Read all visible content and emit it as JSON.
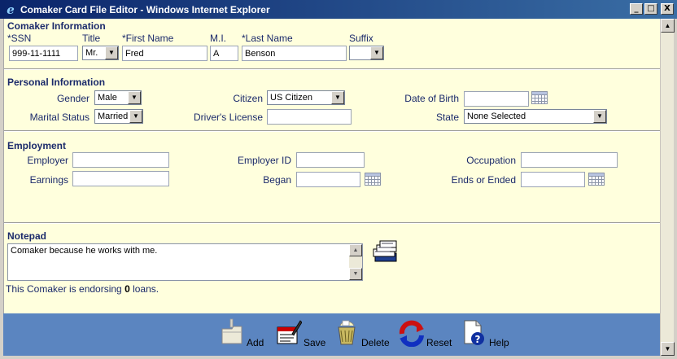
{
  "window": {
    "title": "Comaker Card File Editor - Windows Internet Explorer",
    "minimize_glyph": "_",
    "maximize_glyph": "□",
    "close_glyph": "X",
    "ie_glyph": "e"
  },
  "comaker": {
    "heading": "Comaker Information",
    "ssn_label": "*SSN",
    "ssn_value": "999-11-1111",
    "title_label": "Title",
    "title_value": "Mr.",
    "first_label": "*First Name",
    "first_value": "Fred",
    "mi_label": "M.I.",
    "mi_value": "A",
    "last_label": "*Last Name",
    "last_value": "Benson",
    "suffix_label": "Suffix",
    "suffix_value": ""
  },
  "personal": {
    "heading": "Personal Information",
    "gender_label": "Gender",
    "gender_value": "Male",
    "citizen_label": "Citizen",
    "citizen_value": "US Citizen",
    "dob_label": "Date of Birth",
    "dob_value": "",
    "marital_label": "Marital Status",
    "marital_value": "Married",
    "license_label": "Driver's License",
    "license_value": "",
    "state_label": "State",
    "state_value": "None Selected"
  },
  "employment": {
    "heading": "Employment",
    "employer_label": "Employer",
    "employer_value": "",
    "employer_id_label": "Employer ID",
    "employer_id_value": "",
    "occupation_label": "Occupation",
    "occupation_value": "",
    "earnings_label": "Earnings",
    "earnings_value": "",
    "began_label": "Began",
    "began_value": "",
    "ends_label": "Ends or Ended",
    "ends_value": ""
  },
  "notepad": {
    "heading": "Notepad",
    "text": "Comaker because he works with me."
  },
  "endorse": {
    "prefix": "This Comaker is endorsing ",
    "count": "0",
    "suffix": " loans."
  },
  "footer": {
    "add_label": "Add",
    "save_label": "Save",
    "delete_label": "Delete",
    "reset_label": "Reset",
    "help_label": "Help"
  },
  "colors": {
    "content_bg": "#ffffdd",
    "footer_bg": "#5b85c0",
    "label_text": "#1b2a6b",
    "titlebar_start": "#0a246a",
    "titlebar_end": "#3a6ea5"
  },
  "icons": [
    "ie-icon",
    "calendar-icon",
    "card-stack-icon",
    "add-folder-icon",
    "save-icon",
    "delete-trash-icon",
    "reset-icon",
    "help-icon"
  ]
}
